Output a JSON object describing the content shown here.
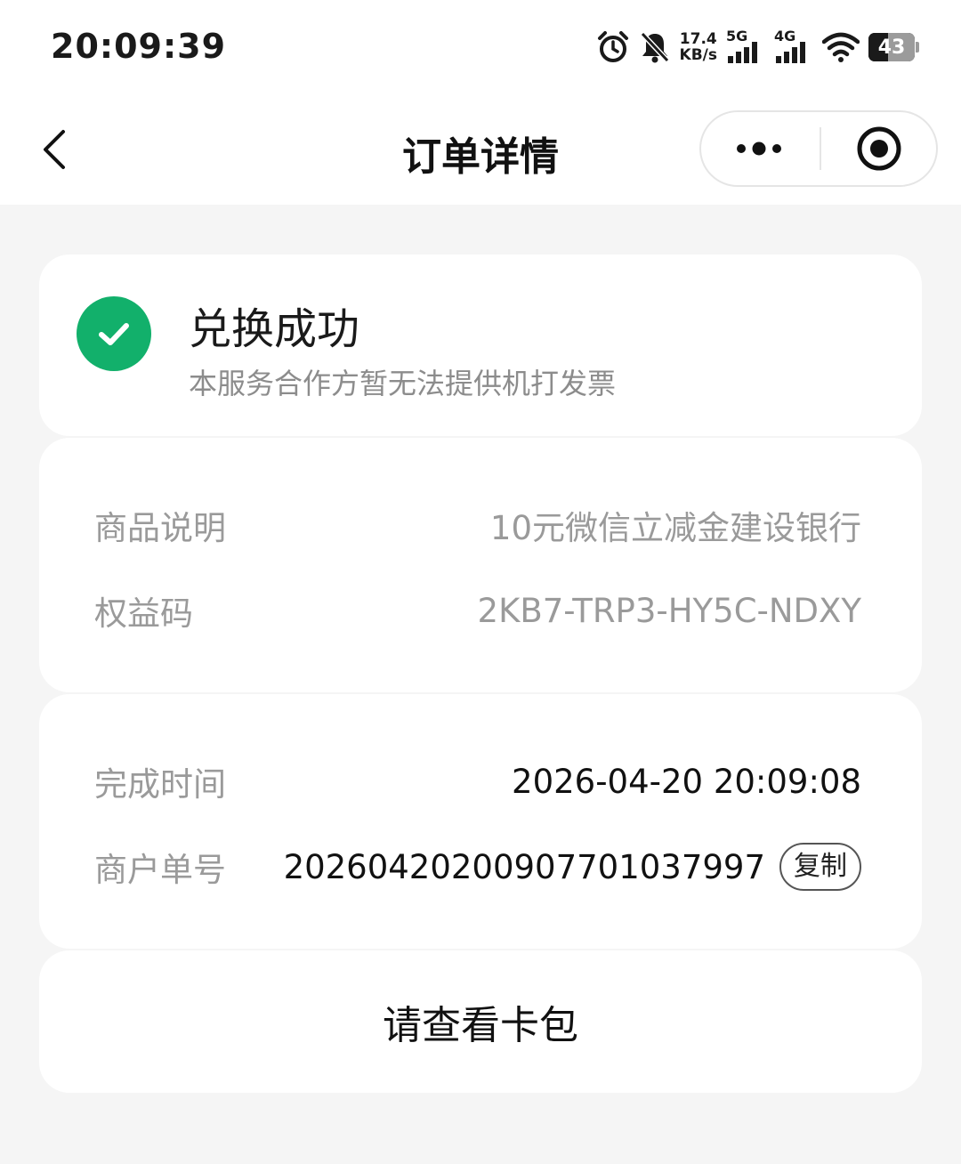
{
  "status_bar": {
    "time": "20:09:39",
    "net_speed_value": "17.4",
    "net_speed_unit": "KB/s",
    "sim1_label": "5G",
    "sim2_label": "4G",
    "battery_level": "43"
  },
  "nav": {
    "title": "订单详情"
  },
  "status_card": {
    "title": "兑换成功",
    "subtitle": "本服务合作方暂无法提供机打发票",
    "icon_color": "#12b06b"
  },
  "info_card": {
    "rows": [
      {
        "label": "商品说明",
        "value": "10元微信立减金建设银行"
      },
      {
        "label": "权益码",
        "value": "2KB7-TRP3-HY5C-NDXY"
      }
    ]
  },
  "time_card": {
    "rows": [
      {
        "label": "完成时间",
        "value": "2026-04-20 20:09:08"
      },
      {
        "label": "商户单号",
        "value": "2026042020090770103799​7"
      }
    ],
    "copy_label": "复制"
  },
  "action_card": {
    "label": "请查看卡包"
  }
}
